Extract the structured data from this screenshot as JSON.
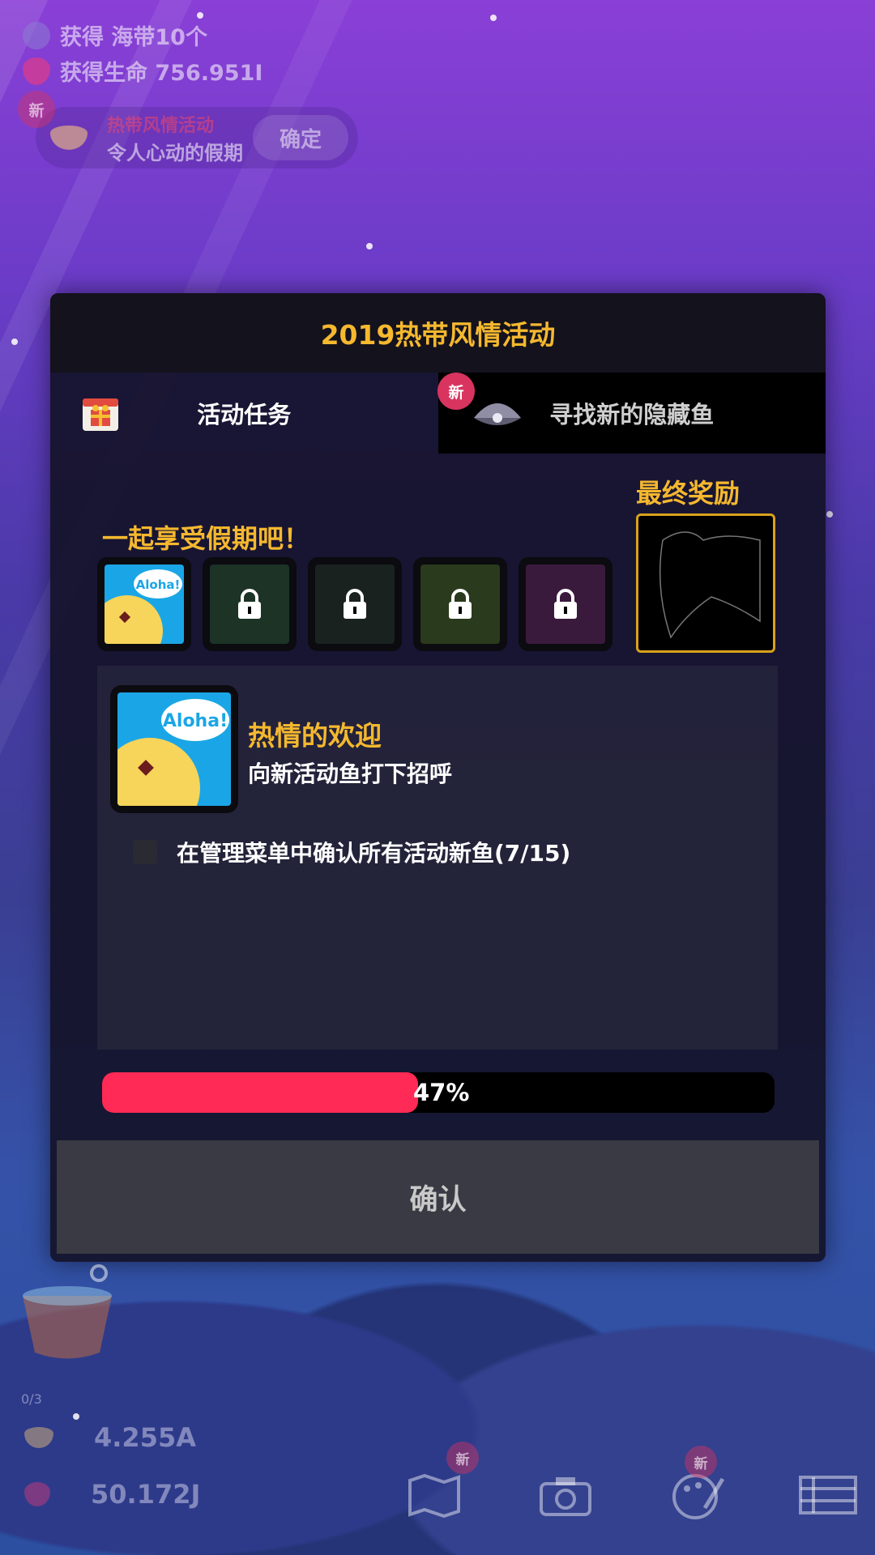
{
  "notifications": [
    {
      "icon": "seaweed-icon",
      "text": "获得 海带10个"
    },
    {
      "icon": "heart-icon",
      "text": "获得生命 756.951I"
    }
  ],
  "toast": {
    "badge": "新",
    "title": "热带风情活动",
    "subtitle": "令人心动的假期",
    "button": "确定"
  },
  "dialog": {
    "title": "2019热带风情活动",
    "tabs": [
      {
        "label": "活动任务",
        "icon": "gift-calendar-icon",
        "active": true
      },
      {
        "label": "寻找新的隐藏鱼",
        "icon": "clam-shell-icon",
        "badge": "新",
        "active": false
      }
    ],
    "section_title": "一起享受假期吧！",
    "final_reward_label": "最终奖励",
    "quests": [
      {
        "name": "aloha",
        "locked": false,
        "bubble": "Aloha!"
      },
      {
        "name": "quest-2",
        "locked": true
      },
      {
        "name": "quest-3",
        "locked": true
      },
      {
        "name": "quest-4",
        "locked": true
      },
      {
        "name": "quest-5",
        "locked": true
      }
    ],
    "current_quest": {
      "bubble": "Aloha!",
      "title": "热情的欢迎",
      "description": "向新活动鱼打下招呼",
      "task": "在管理菜单中确认所有活动新鱼(7/15)",
      "task_done": false
    },
    "progress": {
      "value": 0.47,
      "label": "47%"
    },
    "confirm": "确认"
  },
  "hud": {
    "bucket_count": "0/3",
    "banana_value": "4.255A",
    "heart_value": "50.172J",
    "nav_badges": [
      "新",
      "新"
    ]
  },
  "colors": {
    "accent": "#f5b82e",
    "progress_fill": "#ff2a55",
    "badge": "#d8345f"
  }
}
